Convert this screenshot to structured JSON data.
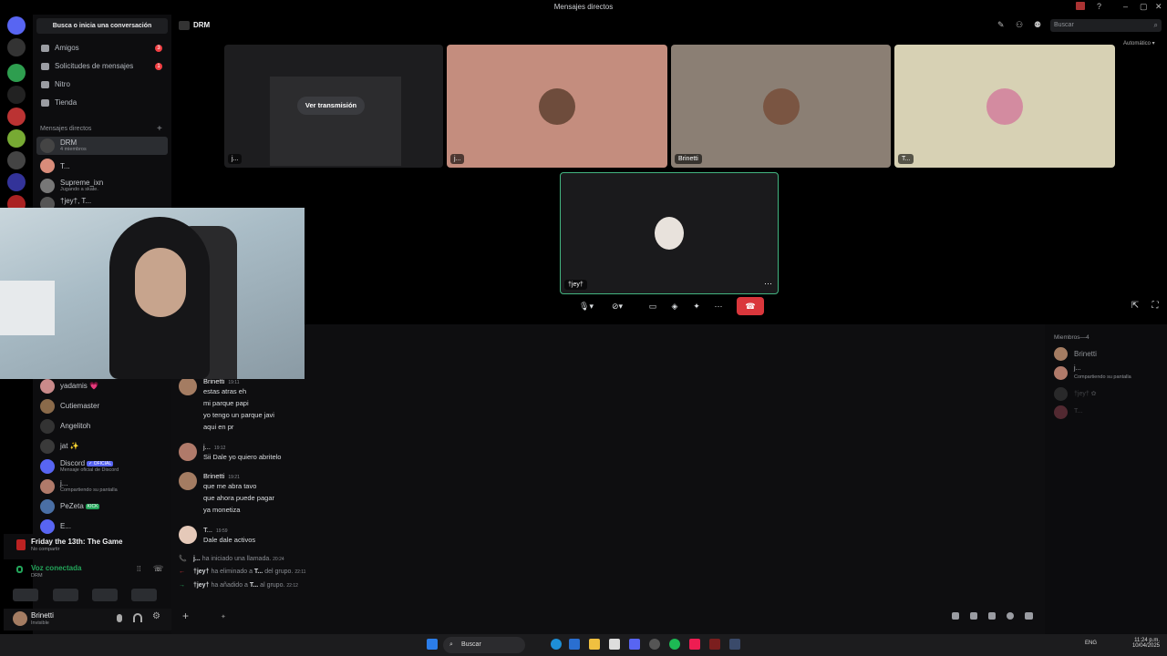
{
  "window": {
    "title": "Mensajes directos",
    "controls": [
      "–",
      "▢",
      "✕"
    ]
  },
  "header": {
    "channel_name": "DRM",
    "search_placeholder": "Buscar",
    "auto_label": "Automático"
  },
  "sidebar": {
    "search_label": "Busca o inicia una conversación",
    "nav": [
      {
        "label": "Amigos",
        "badge": "3"
      },
      {
        "label": "Solicitudes de mensajes",
        "badge": "1"
      },
      {
        "label": "Nitro",
        "badge": ""
      },
      {
        "label": "Tienda",
        "badge": ""
      }
    ],
    "dm_section_label": "Mensajes directos",
    "dm_add": "+",
    "dms_top": [
      {
        "name": "DRM",
        "sub": "4 miembros"
      },
      {
        "name": "T...",
        "sub": ""
      },
      {
        "name": "Supreme_ixn",
        "sub": "Jugando a skate."
      },
      {
        "name": "†jey†, T...",
        "sub": ""
      }
    ],
    "dms_bottom": [
      {
        "name": "yadamis 💗",
        "sub": ""
      },
      {
        "name": "Cutiemaster",
        "sub": ""
      },
      {
        "name": "Angelitoh",
        "sub": ""
      },
      {
        "name": "jat ✨",
        "sub": ""
      },
      {
        "name": "Discord",
        "tag": "✓ OFICIAL",
        "sub": "Mensaje oficial de Discord"
      },
      {
        "name": "j...",
        "sub": "Compartiendo su pantalla"
      },
      {
        "name": "PeZeta",
        "tag": "KICK",
        "sub": ""
      },
      {
        "name": "E...",
        "sub": ""
      }
    ],
    "activity": {
      "title": "Friday the 13th: The Game",
      "sub": "No compartir"
    },
    "voice": {
      "status": "Voz conectada",
      "channel": "DRM"
    },
    "user": {
      "name": "Brinetti",
      "status": "Invisible"
    }
  },
  "call": {
    "tiles": [
      {
        "label": "j...",
        "action": "Ver transmisión"
      },
      {
        "label": "j..."
      },
      {
        "label": "Brinetti"
      },
      {
        "label": "T..."
      },
      {
        "label": "†jey†"
      }
    ]
  },
  "chat": {
    "messages": [
      {
        "author": "Brinetti",
        "time": "19:11",
        "lines": [
          "estas atras eh",
          "mi parque papi",
          "yo tengo un parque javi",
          "aqui en pr"
        ]
      },
      {
        "author": "j...",
        "time": "19:12",
        "lines": [
          "Sii Dale yo quiero abritelo"
        ]
      },
      {
        "author": "Brinetti",
        "time": "19:21",
        "lines": [
          "que me abra tavo",
          "que ahora puede pagar",
          "ya monetiza"
        ]
      },
      {
        "author": "T...",
        "time": "19:59",
        "lines": [
          "Dale dale activos"
        ]
      }
    ],
    "system": [
      {
        "icon": "📞",
        "actor": "j...",
        "text": "ha iniciado una llamada.",
        "time": "20:24"
      },
      {
        "icon": "←",
        "actor": "†jey†",
        "text": "ha eliminado a",
        "target": "T...",
        "text2": "del grupo.",
        "time": "22:11"
      },
      {
        "icon": "→",
        "actor": "†jey†",
        "text": "ha añadido a",
        "target": "T...",
        "text2": "al grupo.",
        "time": "22:12"
      }
    ],
    "composer_plus": "+"
  },
  "members": {
    "header": "Miembros—4",
    "list": [
      {
        "name": "Brinetti",
        "sub": ""
      },
      {
        "name": "j...",
        "sub": "Compartiendo su pantalla"
      },
      {
        "name": "†jey† ✿",
        "sub": ""
      },
      {
        "name": "T...",
        "sub": ""
      }
    ]
  },
  "taskbar": {
    "search": "Buscar",
    "lang": "ENG",
    "time": "11:24 p.m.",
    "date": "10/04/2025"
  },
  "colors": {
    "accent": "#5865f2",
    "danger": "#da373c",
    "online": "#23a55a",
    "speaking": "#43b581"
  }
}
